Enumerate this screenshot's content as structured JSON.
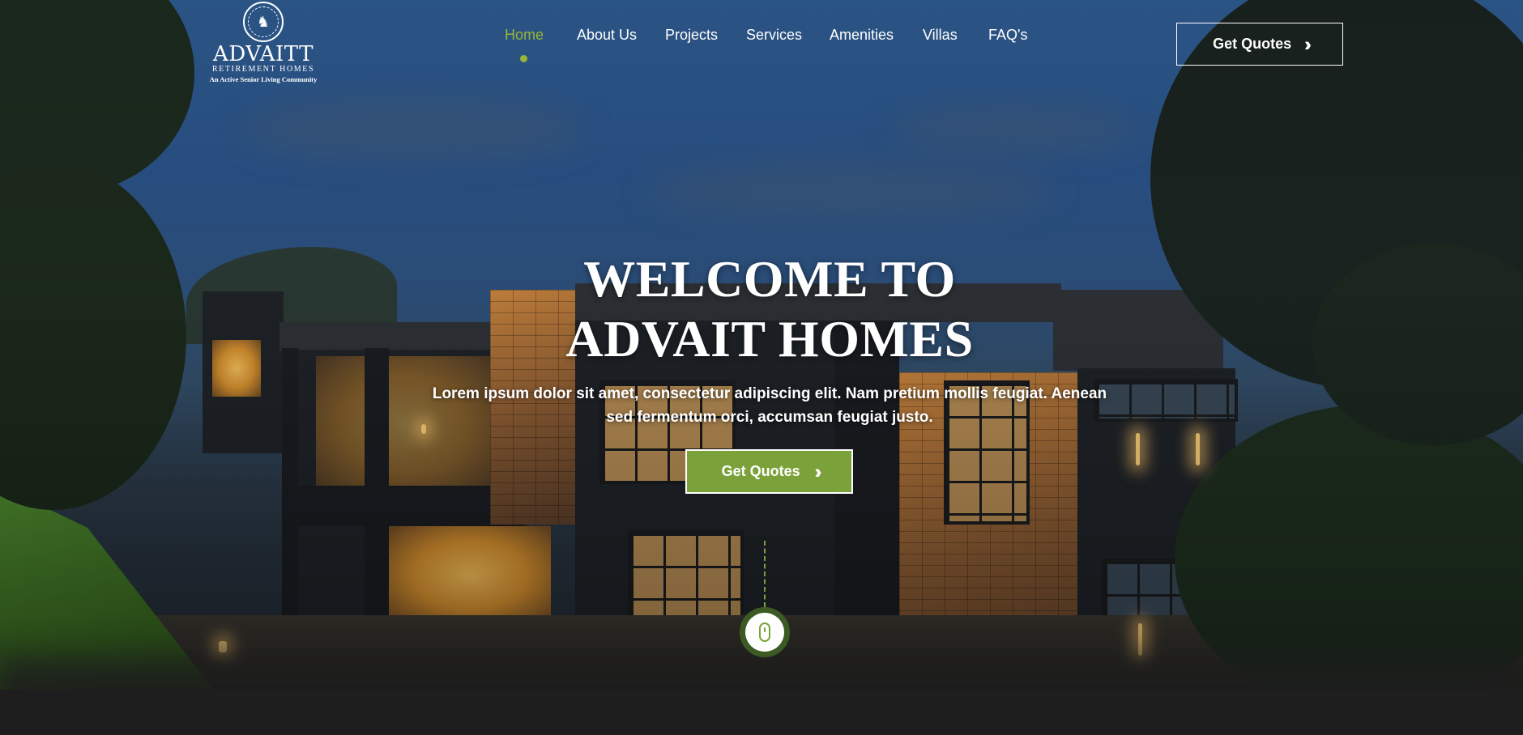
{
  "brand": {
    "name": "ADVAITT",
    "subtitle": "RETIREMENT HOMES",
    "tagline": "An Active Senior Living Community",
    "emblem_icon": "lion-emblem-icon"
  },
  "nav": {
    "items": [
      {
        "label": "Home",
        "active": true
      },
      {
        "label": "About Us",
        "active": false
      },
      {
        "label": "Projects",
        "active": false
      },
      {
        "label": "Services",
        "active": false
      },
      {
        "label": "Amenities",
        "active": false
      },
      {
        "label": "Villas",
        "active": false
      },
      {
        "label": "FAQ's",
        "active": false
      }
    ]
  },
  "header_cta": {
    "label": "Get Quotes",
    "icon": "double-chevron-right-icon"
  },
  "hero": {
    "title_line1": "WELCOME TO",
    "title_line2": "ADVAIT HOMES",
    "text_line1": "Lorem ipsum dolor sit amet, consectetur adipiscing elit. Nam pretium mollis feugiat. Aenean",
    "text_line2": "sed fermentum orci, accumsan feugiat justo.",
    "cta_label": "Get Quotes",
    "cta_icon": "double-chevron-right-icon"
  },
  "scroll_indicator": {
    "icon": "mouse-scroll-icon"
  },
  "colors": {
    "accent": "#7ba23a",
    "active_nav": "#9ab537",
    "text": "#ffffff",
    "footer_band": "#1e1e1e"
  }
}
